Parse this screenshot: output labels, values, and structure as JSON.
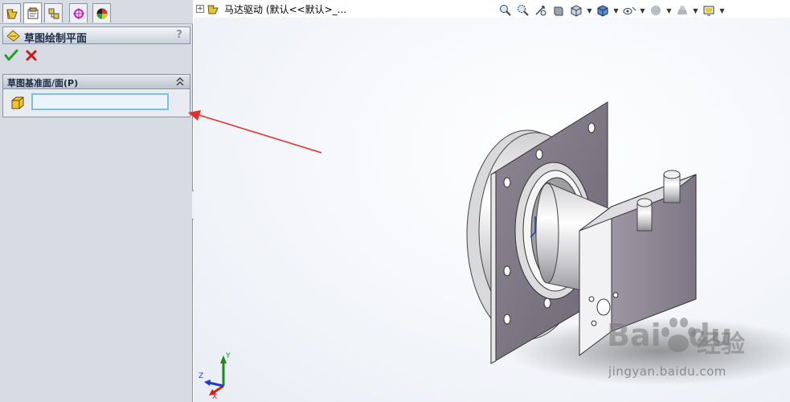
{
  "panel": {
    "tabs": [
      {
        "icon": "featuremanager-icon"
      },
      {
        "icon": "propertymanager-icon"
      },
      {
        "icon": "configurationmanager-icon"
      },
      {
        "icon": "dimxpertmanager-icon"
      },
      {
        "icon": "displaymanager-icon"
      }
    ],
    "title": "草图绘制平面",
    "help": "?",
    "group_title": "草图基准面/面(P)"
  },
  "tree": {
    "expand": "+",
    "root_label": "马达驱动  (默认<<默认>_..."
  },
  "view_toolbar": {
    "icons": [
      "zoom-to-fit-icon",
      "zoom-to-area-icon",
      "previous-view-icon",
      "section-view-icon",
      "view-orientation-icon",
      "display-style-icon",
      "hide-show-items-icon",
      "edit-appearance-icon",
      "apply-scene-icon",
      "view-settings-icon"
    ]
  },
  "triad": {
    "x": "X",
    "y": "Y",
    "z": "Z"
  },
  "watermark": {
    "brand": "Bai",
    "brand2": "du",
    "cn": "经验",
    "url": "jingyan.baidu.com"
  },
  "colors": {
    "panel_bg": "#d6dbe4",
    "accent_ok": "#2a9a2a",
    "accent_cancel": "#d01818",
    "arrow": "#e0302e",
    "selection_border": "#7fbfe6"
  }
}
